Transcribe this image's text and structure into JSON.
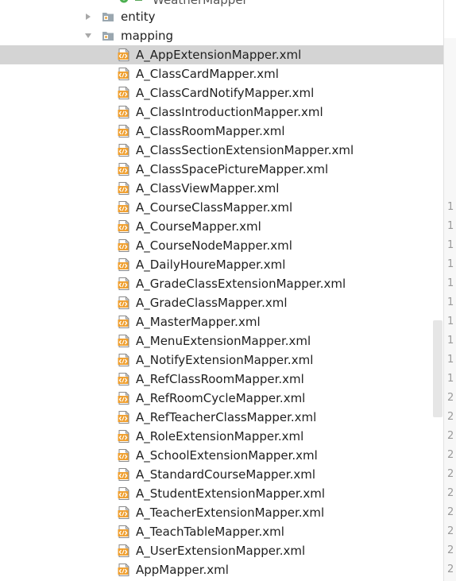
{
  "tree": {
    "partial_item": {
      "label": "WeatherMapper",
      "icon": "java-class-icon"
    },
    "folders": [
      {
        "label": "entity",
        "state": "collapsed",
        "icon": "folder-icon"
      },
      {
        "label": "mapping",
        "state": "expanded",
        "icon": "folder-icon"
      }
    ],
    "files": [
      "A_AppExtensionMapper.xml",
      "A_ClassCardMapper.xml",
      "A_ClassCardNotifyMapper.xml",
      "A_ClassIntroductionMapper.xml",
      "A_ClassRoomMapper.xml",
      "A_ClassSectionExtensionMapper.xml",
      "A_ClassSpacePictureMapper.xml",
      "A_ClassViewMapper.xml",
      "A_CourseClassMapper.xml",
      "A_CourseMapper.xml",
      "A_CourseNodeMapper.xml",
      "A_DailyHoureMapper.xml",
      "A_GradeClassExtensionMapper.xml",
      "A_GradeClassMapper.xml",
      "A_MasterMapper.xml",
      "A_MenuExtensionMapper.xml",
      "A_NotifyExtensionMapper.xml",
      "A_RefClassRoomMapper.xml",
      "A_RefRoomCycleMapper.xml",
      "A_RefTeacherClassMapper.xml",
      "A_RoleExtensionMapper.xml",
      "A_SchoolExtensionMapper.xml",
      "A_StandardCourseMapper.xml",
      "A_StudentExtensionMapper.xml",
      "A_TeacherExtensionMapper.xml",
      "A_TeachTableMapper.xml",
      "A_UserExtensionMapper.xml",
      "AppMapper.xml"
    ],
    "selected_file": "A_AppExtensionMapper.xml",
    "file_icon": "xml-file-icon"
  },
  "gutter": {
    "line_numbers": [
      "1",
      "1",
      "1",
      "1",
      "1",
      "1",
      "1",
      "1",
      "1",
      "1",
      "2",
      "2",
      "2",
      "2",
      "2",
      "2",
      "2",
      "2",
      "2",
      "2"
    ]
  },
  "colors": {
    "selection": "#d4d4d4",
    "folder": "#9aa7b0",
    "xml_icon": "#f0a030",
    "gutter_text": "#9a9a9a"
  }
}
